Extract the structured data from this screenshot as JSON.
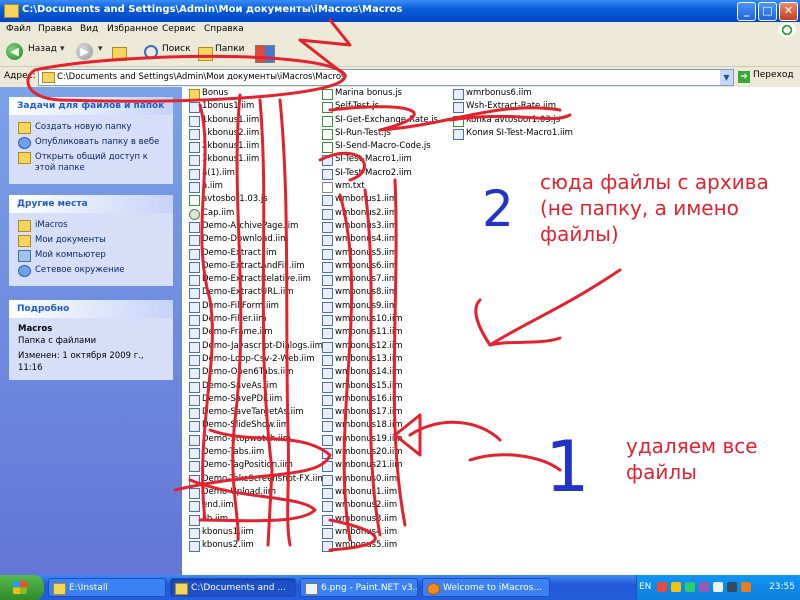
{
  "window": {
    "title": "C:\\Documents and Settings\\Admin\\Мои документы\\iMacros\\Macros",
    "controls": [
      "_",
      "□",
      "✕"
    ]
  },
  "menu": [
    "Файл",
    "Правка",
    "Вид",
    "Избранное",
    "Сервис",
    "Справка"
  ],
  "toolbar": {
    "back_label": "Назад",
    "search_label": "Поиск",
    "folders_label": "Папки"
  },
  "address": {
    "label": "Адрес:",
    "value": "C:\\Documents and Settings\\Admin\\Мои документы\\iMacros\\Macros",
    "go_label": "Переход"
  },
  "sidebar": {
    "tasks": {
      "title": "Задачи для файлов и папок",
      "items": [
        "Создать новую папку",
        "Опубликовать папку в вебе",
        "Открыть общий доступ к этой папке"
      ]
    },
    "places": {
      "title": "Другие места",
      "items": [
        "iMacros",
        "Мои документы",
        "Мой компьютер",
        "Сетевое окружение"
      ]
    },
    "details": {
      "title": "Подробно",
      "name": "Macros",
      "type": "Папка с файлами",
      "modified": "Изменен: 1 октября 2009 г., 11:16"
    }
  },
  "files": {
    "col1": [
      {
        "name": "Bonus",
        "type": "folder"
      },
      {
        "name": "1bonus1.iim",
        "type": "iim"
      },
      {
        "name": "1kbonus1.iim",
        "type": "iim"
      },
      {
        "name": "1kbonus2.iim",
        "type": "iim"
      },
      {
        "name": "2kbonus1.iim",
        "type": "iim"
      },
      {
        "name": "3kbonus1.iim",
        "type": "iim"
      },
      {
        "name": "a(1).iim",
        "type": "iim"
      },
      {
        "name": "a.iim",
        "type": "iim"
      },
      {
        "name": "avtosbor1.03.js",
        "type": "js"
      },
      {
        "name": "Cap.iim",
        "type": "gear"
      },
      {
        "name": "Demo-ArchivePage.iim",
        "type": "iim"
      },
      {
        "name": "Demo-Download.iim",
        "type": "iim"
      },
      {
        "name": "Demo-Extract.iim",
        "type": "iim"
      },
      {
        "name": "Demo-ExtractAndFill.iim",
        "type": "iim"
      },
      {
        "name": "Demo-ExtractRelative.iim",
        "type": "iim"
      },
      {
        "name": "Demo-ExtractURL.iim",
        "type": "iim"
      },
      {
        "name": "Demo-FillForm.iim",
        "type": "iim"
      },
      {
        "name": "Demo-Filter.iim",
        "type": "iim"
      },
      {
        "name": "Demo-Frame.iim",
        "type": "iim"
      },
      {
        "name": "Demo-Javascript-Dialogs.iim",
        "type": "iim"
      },
      {
        "name": "Demo-Loop-Csv-2-Web.iim",
        "type": "iim"
      },
      {
        "name": "Demo-Open6Tabs.iim",
        "type": "iim"
      },
      {
        "name": "Demo-SaveAs.iim",
        "type": "iim"
      },
      {
        "name": "Demo-SavePDF.iim",
        "type": "iim"
      },
      {
        "name": "Demo-SaveTargetAs.iim",
        "type": "iim"
      },
      {
        "name": "Demo-SlideShow.iim",
        "type": "iim"
      },
      {
        "name": "Demo-Stopwatch.iim",
        "type": "iim"
      },
      {
        "name": "Demo-Tabs.iim",
        "type": "iim"
      },
      {
        "name": "Demo-TagPosition.iim",
        "type": "iim"
      },
      {
        "name": "Demo-TakeScreenshot-FX.iim",
        "type": "iim"
      },
      {
        "name": "Demo-Upload.iim",
        "type": "iim"
      },
      {
        "name": "end.iim",
        "type": "iim"
      },
      {
        "name": "kb.iim",
        "type": "iim"
      },
      {
        "name": "kbonus1.iim",
        "type": "iim"
      },
      {
        "name": "kbonus2.iim",
        "type": "iim"
      }
    ],
    "col2": [
      {
        "name": "Marina bonus.js",
        "type": "js"
      },
      {
        "name": "Self-Test.js",
        "type": "js"
      },
      {
        "name": "SI-Get-Exchange-Rate.js",
        "type": "js"
      },
      {
        "name": "SI-Run-Test.js",
        "type": "js"
      },
      {
        "name": "SI-Send-Macro-Code.js",
        "type": "js"
      },
      {
        "name": "SI-Test-Macro1.iim",
        "type": "iim"
      },
      {
        "name": "SI-Test-Macro2.iim",
        "type": "iim"
      },
      {
        "name": "wm.txt",
        "type": "txt"
      },
      {
        "name": "wmbonus1.iim",
        "type": "iim"
      },
      {
        "name": "wmbonus2.iim",
        "type": "iim"
      },
      {
        "name": "wmbonus3.iim",
        "type": "iim"
      },
      {
        "name": "wmbonus4.iim",
        "type": "iim"
      },
      {
        "name": "wmbonus5.iim",
        "type": "iim"
      },
      {
        "name": "wmbonus6.iim",
        "type": "iim"
      },
      {
        "name": "wmbonus7.iim",
        "type": "iim"
      },
      {
        "name": "wmbonus8.iim",
        "type": "iim"
      },
      {
        "name": "wmbonus9.iim",
        "type": "iim"
      },
      {
        "name": "wmbonus10.iim",
        "type": "iim"
      },
      {
        "name": "wmbonus11.iim",
        "type": "iim"
      },
      {
        "name": "wmbonus12.iim",
        "type": "iim"
      },
      {
        "name": "wmbonus13.iim",
        "type": "iim"
      },
      {
        "name": "wmbonus14.iim",
        "type": "iim"
      },
      {
        "name": "wmbonus15.iim",
        "type": "iim"
      },
      {
        "name": "wmbonus16.iim",
        "type": "iim"
      },
      {
        "name": "wmbonus17.iim",
        "type": "iim"
      },
      {
        "name": "wmbonus18.iim",
        "type": "iim"
      },
      {
        "name": "wmbonus19.iim",
        "type": "iim"
      },
      {
        "name": "wmbonus20.iim",
        "type": "iim"
      },
      {
        "name": "wmbonus21.iim",
        "type": "iim"
      },
      {
        "name": "wmbonus0.iim",
        "type": "iim"
      },
      {
        "name": "wmbonus1.iim",
        "type": "iim"
      },
      {
        "name": "wmbonus2.iim",
        "type": "iim"
      },
      {
        "name": "wmbonus3.iim",
        "type": "iim"
      },
      {
        "name": "wmbonus4.iim",
        "type": "iim"
      },
      {
        "name": "wmbonus5.iim",
        "type": "iim"
      }
    ],
    "col3": [
      {
        "name": "wmrbonus6.iim",
        "type": "iim"
      },
      {
        "name": "Wsh-Extract-Rate.iim",
        "type": "iim"
      },
      {
        "name": "Konka avtosbor1.03.js",
        "type": "js"
      },
      {
        "name": "Копия SI-Test-Macro1.iim",
        "type": "iim"
      }
    ]
  },
  "annotations": {
    "top_text": "сюда файлы с архива (не папку, а имено файлы)",
    "top_number": "2",
    "bottom_text": "удаляем все файлы",
    "bottom_number": "1"
  },
  "taskbar": {
    "tasks": [
      "E:\\Install",
      "C:\\Documents and ...",
      "6.png - Paint.NET v3...",
      "Welcome to iMacros..."
    ],
    "lang": "EN",
    "clock": "23:55"
  }
}
